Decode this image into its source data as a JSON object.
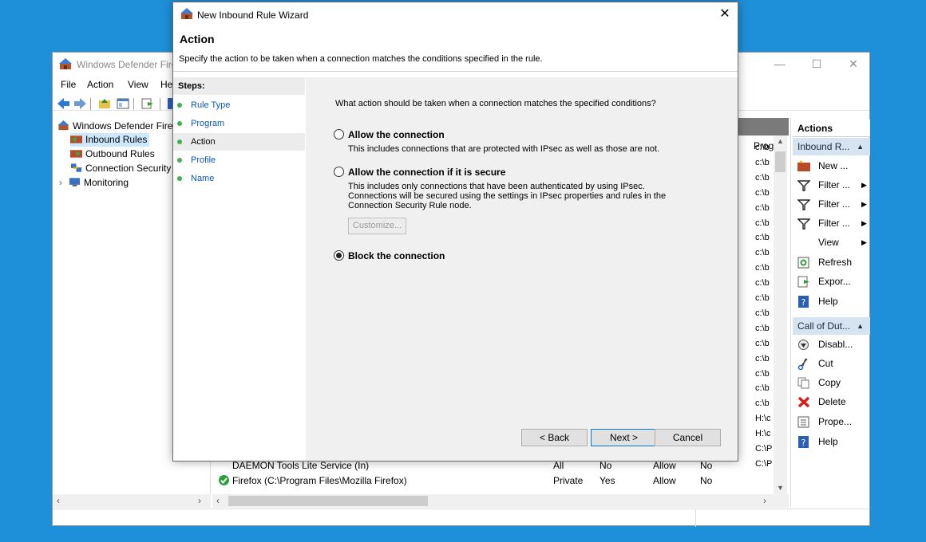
{
  "mmc": {
    "title": "Windows Defender Fire",
    "window_controls": {
      "minimize": "—",
      "maximize": "☐",
      "close": "✕"
    },
    "menu": [
      "File",
      "Action",
      "View",
      "He"
    ],
    "tree": [
      "Windows Defender Firev",
      "Inbound Rules",
      "Outbound Rules",
      "Connection Security",
      "Monitoring"
    ],
    "list": {
      "column_program": "Prog",
      "path_cells": [
        "c:\\b",
        "c:\\b",
        "c:\\b",
        "c:\\b",
        "c:\\b",
        "c:\\b",
        "c:\\b",
        "c:\\b",
        "c:\\b",
        "c:\\b",
        "c:\\b",
        "c:\\b",
        "c:\\b",
        "c:\\b",
        "c:\\b",
        "c:\\b",
        "c:\\b",
        "c:\\b",
        "H:\\c",
        "H:\\c",
        "C:\\P",
        "C:\\P"
      ],
      "rows": [
        {
          "name": "DAEMON Tools Lite Service (In)",
          "profile": "All",
          "enabled": "No",
          "action": "Allow",
          "override": "No"
        },
        {
          "name": "Firefox (C:\\Program Files\\Mozilla Firefox)",
          "profile": "Private",
          "enabled": "Yes",
          "action": "Allow",
          "override": "No"
        }
      ]
    },
    "actions": {
      "header": "Actions",
      "section1": "Inbound R...",
      "section1_items": [
        "New ...",
        "Filter ...",
        "Filter ...",
        "Filter ...",
        "View",
        "Refresh",
        "Expor...",
        "Help"
      ],
      "section2": "Call of Dut...",
      "section2_items": [
        "Disabl...",
        "Cut",
        "Copy",
        "Delete",
        "Prope...",
        "Help"
      ]
    }
  },
  "wizard": {
    "title": "New Inbound Rule Wizard",
    "heading": "Action",
    "description": "Specify the action to be taken when a connection matches the conditions specified in the rule.",
    "steps_header": "Steps:",
    "steps": [
      "Rule Type",
      "Program",
      "Action",
      "Profile",
      "Name"
    ],
    "current_step": "Action",
    "question": "What action should be taken when a connection matches the specified conditions?",
    "options": [
      {
        "label": "Allow the connection",
        "description": "This includes connections that are protected with IPsec as well as those are not.",
        "checked": false
      },
      {
        "label": "Allow the connection if it is secure",
        "description": "This includes only connections that have been authenticated by using IPsec.  Connections will be secured using the settings in IPsec properties and rules in the Connection Security Rule node.",
        "checked": false
      },
      {
        "label": "Block the connection",
        "description": "",
        "checked": true
      }
    ],
    "customize_label": "Customize...",
    "back_label": "< Back",
    "next_label": "Next >",
    "cancel_label": "Cancel",
    "close_glyph": "✕"
  },
  "colors": {
    "desktop": "#1e90d9",
    "link_blue": "#0b56b3",
    "step_dot": "#3cb44a",
    "accent": "#0078d7"
  }
}
